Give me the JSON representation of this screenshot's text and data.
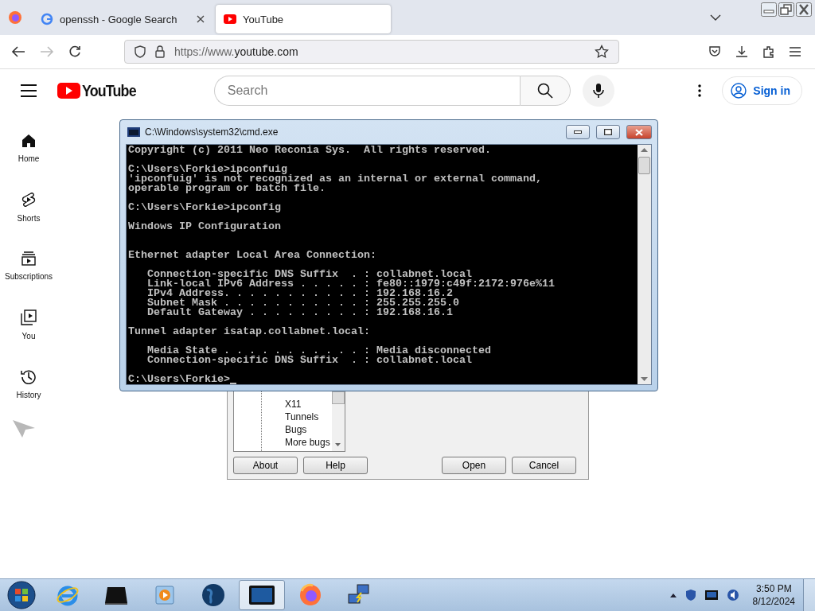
{
  "browser": {
    "tabs": [
      {
        "title": "openssh - Google Search",
        "kind": "google",
        "selected": false
      },
      {
        "title": "YouTube",
        "kind": "youtube",
        "selected": true
      }
    ],
    "url": {
      "prefix": "https://www.",
      "domain": "youtube.com"
    }
  },
  "youtube": {
    "logo": "YouTube",
    "search_placeholder": "Search",
    "sign_in": "Sign in",
    "sidebar": [
      {
        "label": "Home",
        "kind": "home"
      },
      {
        "label": "Shorts",
        "kind": "shorts"
      },
      {
        "label": "Subscriptions",
        "kind": "subscriptions"
      },
      {
        "label": "You",
        "kind": "you"
      },
      {
        "label": "History",
        "kind": "history"
      }
    ]
  },
  "cmd": {
    "title": "C:\\Windows\\system32\\cmd.exe",
    "blocks": [
      {
        "lines": [
          "Copyright (c) 2011 Neo Reconia Sys.  All rights reserved."
        ]
      },
      {
        "lines": [
          "C:\\Users\\Forkie>ipconfuig",
          "'ipconfuig' is not recognized as an internal or external command,",
          "operable program or batch file."
        ]
      },
      {
        "lines": [
          "C:\\Users\\Forkie>ipconfig"
        ]
      },
      {
        "lines": [
          "Windows IP Configuration"
        ]
      },
      {
        "lines": [
          "Ethernet adapter Local Area Connection:"
        ]
      },
      {
        "lines": [
          "   Connection-specific DNS Suffix  . : collabnet.local",
          "   Link-local IPv6 Address . . . . . : fe80::1979:c49f:2172:976e%11",
          "   IPv4 Address. . . . . . . . . . . : 192.168.16.2",
          "   Subnet Mask . . . . . . . . . . . : 255.255.255.0",
          "   Default Gateway . . . . . . . . . : 192.168.16.1"
        ]
      },
      {
        "lines": [
          "Tunnel adapter isatap.collabnet.local:"
        ]
      },
      {
        "lines": [
          "   Media State . . . . . . . . . . . : Media disconnected",
          "   Connection-specific DNS Suffix  . : collabnet.local"
        ]
      }
    ],
    "prompt": "C:\\Users\\Forkie>"
  },
  "putty": {
    "tree": [
      "X11",
      "Tunnels",
      "Bugs",
      "More bugs"
    ],
    "buttons": [
      "About",
      "Help",
      "Open",
      "Cancel"
    ]
  },
  "taskbar": {
    "apps": [
      {
        "kind": "ie",
        "active": false
      },
      {
        "kind": "drive",
        "active": false
      },
      {
        "kind": "media",
        "active": false
      },
      {
        "kind": "globe",
        "active": false
      },
      {
        "kind": "console",
        "active": true
      },
      {
        "kind": "firefox",
        "active": false
      },
      {
        "kind": "network",
        "active": false
      }
    ],
    "time": "3:50 PM",
    "date": "8/12/2024"
  }
}
